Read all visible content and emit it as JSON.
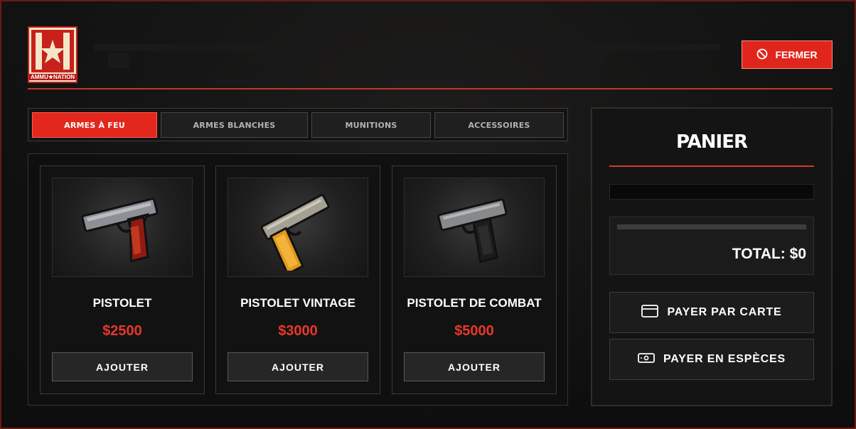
{
  "logo": {
    "name": "AMMU★NATION",
    "brand_color": "#c8201a"
  },
  "header": {
    "close_label": "FERMER",
    "close_icon": "ban-icon"
  },
  "tabs": [
    {
      "label": "ARMES À FEU",
      "active": true
    },
    {
      "label": "ARMES BLANCHES",
      "active": false
    },
    {
      "label": "MUNITIONS",
      "active": false
    },
    {
      "label": "ACCESSOIRES",
      "active": false
    }
  ],
  "products": [
    {
      "name": "PISTOLET",
      "price": "$2500",
      "button": "AJOUTER",
      "image": "pistol-icon"
    },
    {
      "name": "PISTOLET VINTAGE",
      "price": "$3000",
      "button": "AJOUTER",
      "image": "vintage-pistol-icon"
    },
    {
      "name": "PISTOLET DE COMBAT",
      "price": "$5000",
      "button": "AJOUTER",
      "image": "combat-pistol-icon"
    }
  ],
  "cart": {
    "title": "PANIER",
    "total": "TOTAL: $0",
    "pay_card": "PAYER PAR CARTE",
    "pay_cash": "PAYER EN ESPÈCES"
  },
  "colors": {
    "accent": "#e3271c",
    "price": "#e8382c",
    "background": "#121212"
  }
}
